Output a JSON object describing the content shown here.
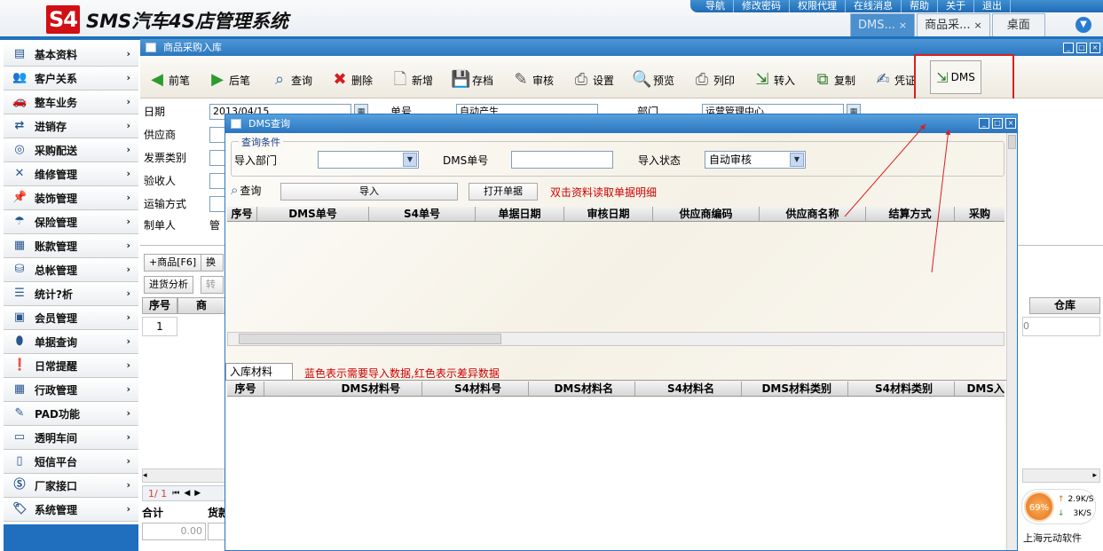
{
  "app": {
    "logo_text": "S4",
    "title": "SMS汽车4S店管理系统"
  },
  "top_menu": [
    "导航",
    "修改密码",
    "权限代理",
    "在线消息",
    "帮助",
    "关于",
    "退出"
  ],
  "tabs": [
    {
      "label": "DMS...",
      "active": true
    },
    {
      "label": "商品采...",
      "active": false
    },
    {
      "label": "桌面",
      "active": false
    }
  ],
  "tab_close_glyph": "×",
  "sidebar": {
    "items": [
      {
        "label": "基本资料",
        "icon": "document-icon"
      },
      {
        "label": "客户关系",
        "icon": "users-icon"
      },
      {
        "label": "整车业务",
        "icon": "car-icon"
      },
      {
        "label": "进销存",
        "icon": "shuffle-icon"
      },
      {
        "label": "采购配送",
        "icon": "target-icon"
      },
      {
        "label": "维修管理",
        "icon": "tools-icon"
      },
      {
        "label": "装饰管理",
        "icon": "pin-icon"
      },
      {
        "label": "保险管理",
        "icon": "umbrella-icon"
      },
      {
        "label": "账款管理",
        "icon": "calculator-icon"
      },
      {
        "label": "总帐管理",
        "icon": "basket-icon"
      },
      {
        "label": "统计?析",
        "icon": "list-icon"
      },
      {
        "label": "会员管理",
        "icon": "member-card-icon"
      },
      {
        "label": "单据查询",
        "icon": "mouse-icon"
      },
      {
        "label": "日常提醒",
        "icon": "alert-icon"
      },
      {
        "label": "行政管理",
        "icon": "calendar-icon"
      },
      {
        "label": "PAD功能",
        "icon": "edit-icon"
      },
      {
        "label": "透明车间",
        "icon": "monitor-icon"
      },
      {
        "label": "短信平台",
        "icon": "phone-icon"
      },
      {
        "label": "厂家接口",
        "icon": "factory-icon"
      },
      {
        "label": "系统管理",
        "icon": "tag-icon"
      }
    ]
  },
  "window": {
    "title": "商品采购入库"
  },
  "toolbar": {
    "prev": "前笔",
    "next": "后笔",
    "query": "查询",
    "delete": "删除",
    "new": "新增",
    "save": "存档",
    "audit": "审核",
    "settings": "设置",
    "preview": "预览",
    "print": "列印",
    "transfer": "转入",
    "copy": "复制",
    "voucher": "凭证",
    "dms": "DMS"
  },
  "form": {
    "date_label": "日期",
    "date_value": "2013/04/15",
    "doc_no_label": "单号",
    "doc_no_value": "自动产生",
    "dept_label": "部门",
    "dept_value": "运营管理中心",
    "supplier_label": "供应商",
    "invoice_label": "发票类别",
    "receiver_label": "验收人",
    "shipping_label": "运输方式",
    "creator_label": "制单人",
    "creator_value": "管"
  },
  "lower": {
    "add_goods_btn": "+商品[F6]",
    "btn2": "换",
    "analysis_btn": "进货分析",
    "btn4": "转",
    "col_seq": "序号",
    "col_goods": "商",
    "col_warehouse": "仓库",
    "row1_seq": "1",
    "row1_tail": "0",
    "pager": "1/ 1",
    "pager_first": "⏮",
    "pager_prev": "◀",
    "pager_next": "▶",
    "total_label": "合计",
    "total_col2": "货款",
    "total_value": "0.00"
  },
  "dialog": {
    "title": "DMS查询",
    "group_label": "查询条件",
    "import_dept_label": "导入部门",
    "dms_no_label": "DMS单号",
    "import_status_label": "导入状态",
    "import_status_value": "自动审核",
    "query_btn": "查询",
    "import_btn": "导入",
    "open_doc_btn": "打开单据",
    "hint": "双击资料读取单据明细",
    "grid1_headers": [
      "序号",
      "DMS单号",
      "S4单号",
      "单据日期",
      "审核日期",
      "供应商编码",
      "供应商名称",
      "结算方式",
      "采购"
    ],
    "tab_label": "入库材料",
    "legend_text": "蓝色表示需要导入数据,红色表示差异数据",
    "grid2_headers": [
      "序号",
      "DMS材料号",
      "S4材料号",
      "DMS材料名",
      "S4材料名",
      "DMS材料类别",
      "S4材料类别",
      "DMS入"
    ]
  },
  "net_monitor": {
    "percent": "69%",
    "upload": "2.9K/S",
    "download": "3K/S"
  },
  "footer_brand": "上海元动软件",
  "colors": {
    "accent_blue": "#2b76c0",
    "highlight_red": "#d81f1f",
    "hint_red": "#cc0000"
  }
}
